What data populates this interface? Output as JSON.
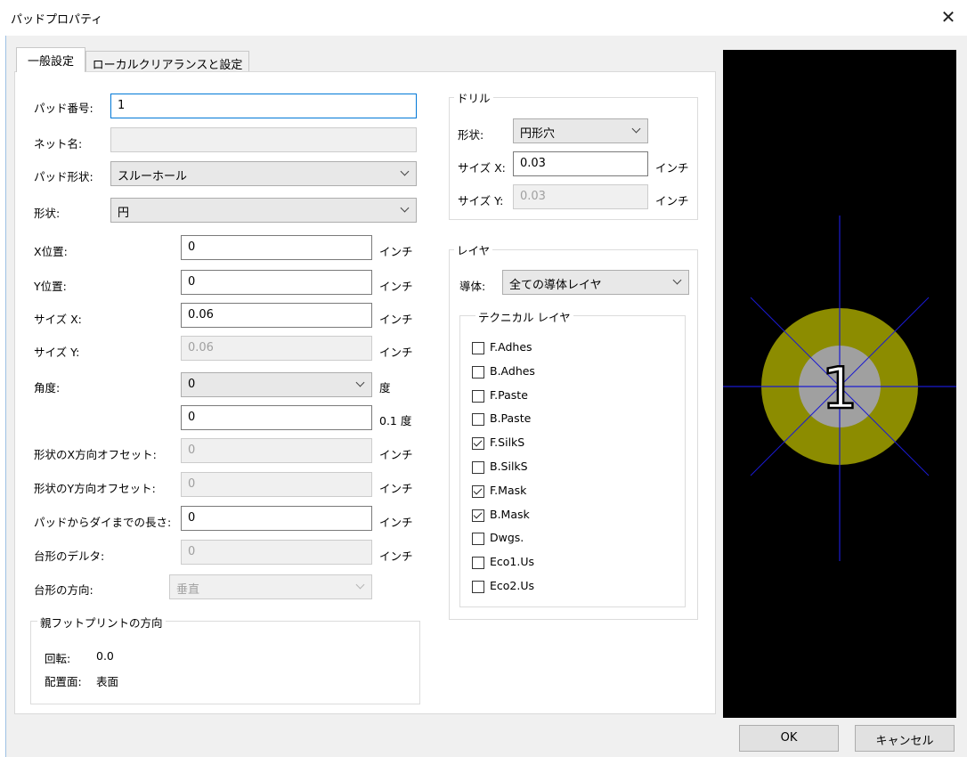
{
  "window": {
    "title": "パッドプロパティ",
    "close_glyph": "✕"
  },
  "tabs": [
    {
      "label": "一般設定"
    },
    {
      "label": "ローカルクリアランスと設定"
    }
  ],
  "pad": {
    "number_label": "パッド番号:",
    "number": "1",
    "net_label": "ネット名:",
    "net": "",
    "type_label": "パッド形状:",
    "type": "スルーホール",
    "shape_label": "形状:",
    "shape": "円",
    "xpos_label": "X位置:",
    "xpos": "0",
    "ypos_label": "Y位置:",
    "ypos": "0",
    "sizex_label": "サイズ X:",
    "sizex": "0.06",
    "sizey_label": "サイズ Y:",
    "sizey": "0.06",
    "angle_label": "角度:",
    "angle": "0",
    "angle_unit": "度",
    "angle_tenth": "0",
    "angle_tenth_unit": "0.1 度",
    "offx_label": "形状のX方向オフセット:",
    "offx": "0",
    "offy_label": "形状のY方向オフセット:",
    "offy": "0",
    "die_label": "パッドからダイまでの長さ:",
    "die": "0",
    "delta_label": "台形のデルタ:",
    "delta": "0",
    "trap_dir_label": "台形の方向:",
    "trap_dir": "垂直",
    "unit": "インチ"
  },
  "parent": {
    "title": "親フットプリントの方向",
    "rotation_label": "回転:",
    "rotation": "0.0",
    "side_label": "配置面:",
    "side": "表面"
  },
  "drill": {
    "title": "ドリル",
    "shape_label": "形状:",
    "shape": "円形穴",
    "sizex_label": "サイズ X:",
    "sizex": "0.03",
    "sizey_label": "サイズ Y:",
    "sizey": "0.03",
    "unit": "インチ"
  },
  "layers": {
    "title": "レイヤ",
    "copper_label": "導体:",
    "copper": "全ての導体レイヤ",
    "tech_title": "テクニカル レイヤ",
    "items": [
      {
        "label": "F.Adhes",
        "checked": false
      },
      {
        "label": "B.Adhes",
        "checked": false
      },
      {
        "label": "F.Paste",
        "checked": false
      },
      {
        "label": "B.Paste",
        "checked": false
      },
      {
        "label": "F.SilkS",
        "checked": true
      },
      {
        "label": "B.SilkS",
        "checked": false
      },
      {
        "label": "F.Mask",
        "checked": true
      },
      {
        "label": "B.Mask",
        "checked": true
      },
      {
        "label": "Dwgs.",
        "checked": false
      },
      {
        "label": "Eco1.Us",
        "checked": false
      },
      {
        "label": "Eco2.Us",
        "checked": false
      }
    ]
  },
  "preview": {
    "pad_number": "1",
    "pad_color": "#8c8c00",
    "hole_color": "#a0a0a0",
    "axis_color": "#1a1ad0"
  },
  "buttons": {
    "ok": "OK",
    "cancel": "キャンセル"
  }
}
